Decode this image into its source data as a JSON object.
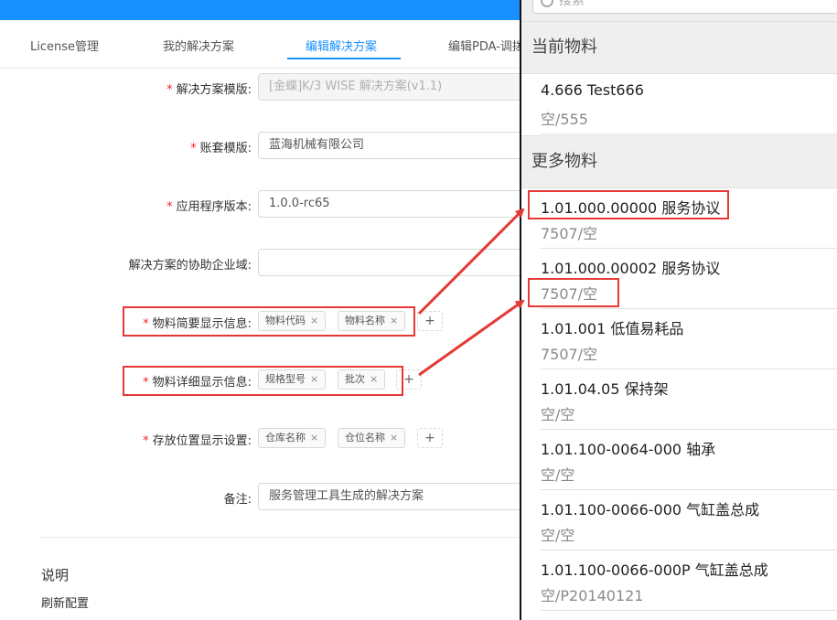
{
  "tabs": [
    {
      "label": "License管理"
    },
    {
      "label": "我的解决方案"
    },
    {
      "label": "编辑解决方案",
      "active": true
    },
    {
      "label": "编辑PDA-调拨"
    }
  ],
  "form": {
    "template": {
      "label": "解决方案模版:",
      "value": "[金蝶]K/3 WISE 解决方案(v1.1)"
    },
    "account": {
      "label": "账套模版:",
      "value": "蓝海机械有限公司"
    },
    "version": {
      "label": "应用程序版本:",
      "value": "1.0.0-rc65"
    },
    "domain": {
      "label": "解决方案的协助企业域:",
      "value": ""
    },
    "brief": {
      "label": "物料简要显示信息:",
      "tags": [
        "物料代码",
        "物料名称"
      ]
    },
    "detail": {
      "label": "物料详细显示信息:",
      "tags": [
        "规格型号",
        "批次"
      ]
    },
    "location": {
      "label": "存放位置显示设置:",
      "tags": [
        "仓库名称",
        "仓位名称"
      ]
    },
    "remark": {
      "label": "备注:",
      "value": "服务管理工具生成的解决方案"
    },
    "required_mark": "*",
    "add_symbol": "+",
    "remove_symbol": "×"
  },
  "section": {
    "title": "说明",
    "link": "刷新配置"
  },
  "panel": {
    "search_placeholder": "搜索",
    "current_header": "当前物料",
    "current_item": {
      "title": "4.666 Test666",
      "sub": "空/555"
    },
    "more_header": "更多物料",
    "items": [
      {
        "title": "1.01.000.00000 服务协议",
        "sub": "7507/空"
      },
      {
        "title": "1.01.000.00002 服务协议",
        "sub": "7507/空"
      },
      {
        "title": "1.01.001 低值易耗品",
        "sub": "7507/空"
      },
      {
        "title": "1.01.04.05 保持架",
        "sub": "空/空"
      },
      {
        "title": "1.01.100-0064-000 轴承",
        "sub": "空/空"
      },
      {
        "title": "1.01.100-0066-000 气缸盖总成",
        "sub": "空/空"
      },
      {
        "title": "1.01.100-0066-000P 气缸盖总成",
        "sub": "空/P20140121"
      }
    ]
  },
  "colors": {
    "accent": "#1890ff",
    "highlight": "#e53935",
    "required": "#f5222d"
  }
}
